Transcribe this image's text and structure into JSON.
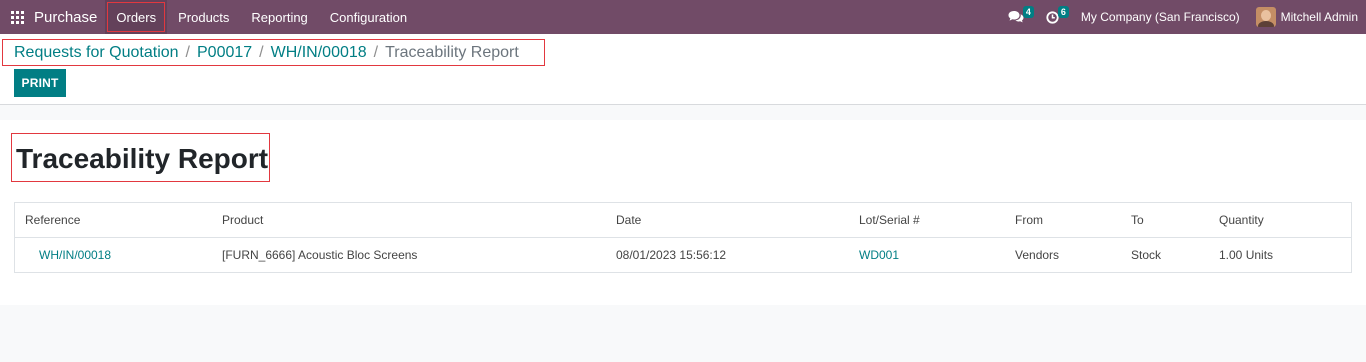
{
  "navbar": {
    "app_name": "Purchase",
    "menu": [
      "Orders",
      "Products",
      "Reporting",
      "Configuration"
    ],
    "messages_count": "4",
    "activities_count": "6",
    "company": "My Company (San Francisco)",
    "user": "Mitchell Admin"
  },
  "breadcrumb": {
    "items": [
      "Requests for Quotation",
      "P00017",
      "WH/IN/00018"
    ],
    "current": "Traceability Report",
    "separator": "/"
  },
  "actions": {
    "print_label": "PRINT"
  },
  "report": {
    "title": "Traceability Report",
    "columns": [
      "Reference",
      "Product",
      "Date",
      "Lot/Serial #",
      "From",
      "To",
      "Quantity"
    ],
    "rows": [
      {
        "reference": "WH/IN/00018",
        "product": "[FURN_6666] Acoustic Bloc Screens",
        "date": "08/01/2023 15:56:12",
        "lot": "WD001",
        "from": "Vendors",
        "to": "Stock",
        "quantity": "1.00 Units"
      }
    ]
  },
  "colors": {
    "navbar": "#714b67",
    "accent": "#017e84",
    "highlight": "#e2383f"
  }
}
